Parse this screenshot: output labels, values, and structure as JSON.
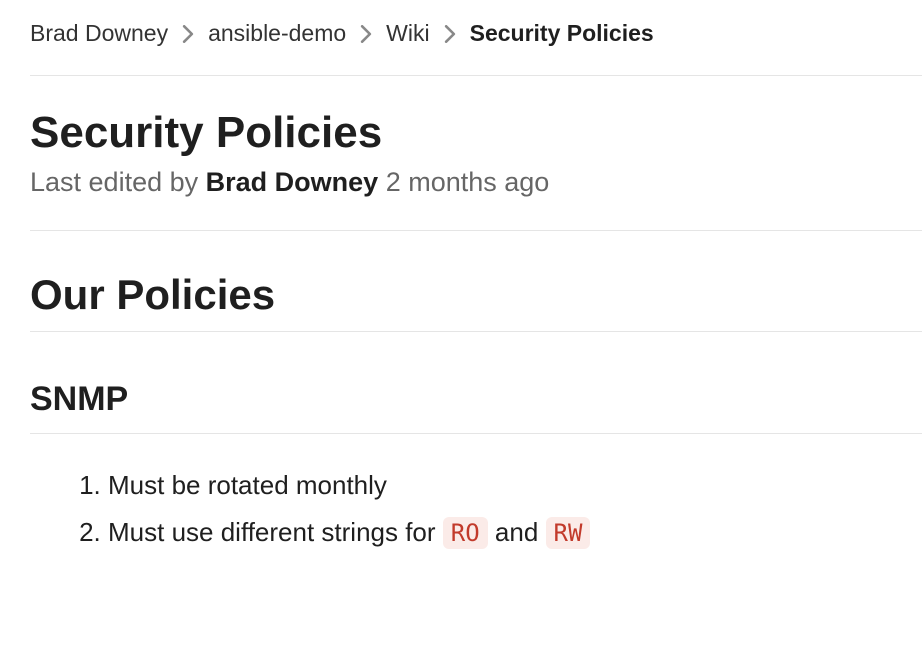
{
  "breadcrumb": {
    "items": [
      {
        "label": "Brad Downey"
      },
      {
        "label": "ansible-demo"
      },
      {
        "label": "Wiki"
      },
      {
        "label": "Security Policies"
      }
    ]
  },
  "page": {
    "title": "Security Policies",
    "last_edited_prefix": "Last edited by ",
    "author": "Brad Downey",
    "time_ago": "2 months ago"
  },
  "content": {
    "h1": "Our Policies",
    "h2": "SNMP",
    "list": {
      "item1": "Must be rotated monthly",
      "item2_prefix": "Must use different strings for ",
      "item2_code1": "RO",
      "item2_mid": " and ",
      "item2_code2": "RW"
    }
  }
}
